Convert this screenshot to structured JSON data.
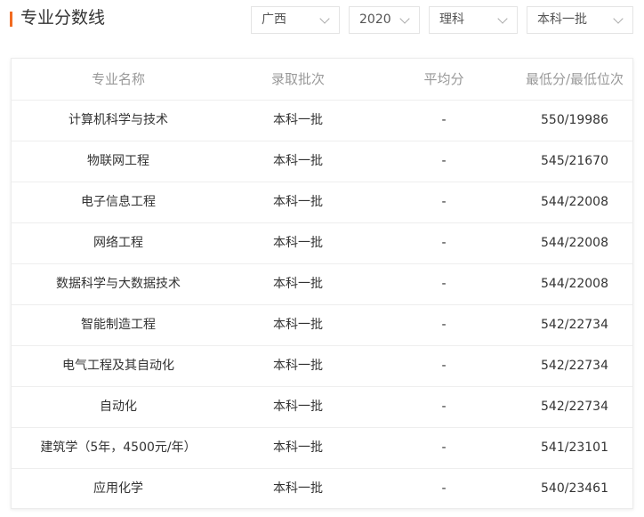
{
  "header": {
    "title": "专业分数线"
  },
  "filters": {
    "province": "广西",
    "year": "2020",
    "subject": "理科",
    "batch": "本科一批"
  },
  "table": {
    "columns": [
      "专业名称",
      "录取批次",
      "平均分",
      "最低分/最低位次"
    ],
    "rows": [
      {
        "major": "计算机科学与技术",
        "batch": "本科一批",
        "avg": "-",
        "min": "550/19986"
      },
      {
        "major": "物联网工程",
        "batch": "本科一批",
        "avg": "-",
        "min": "545/21670"
      },
      {
        "major": "电子信息工程",
        "batch": "本科一批",
        "avg": "-",
        "min": "544/22008"
      },
      {
        "major": "网络工程",
        "batch": "本科一批",
        "avg": "-",
        "min": "544/22008"
      },
      {
        "major": "数据科学与大数据技术",
        "batch": "本科一批",
        "avg": "-",
        "min": "544/22008"
      },
      {
        "major": "智能制造工程",
        "batch": "本科一批",
        "avg": "-",
        "min": "542/22734"
      },
      {
        "major": "电气工程及其自动化",
        "batch": "本科一批",
        "avg": "-",
        "min": "542/22734"
      },
      {
        "major": "自动化",
        "batch": "本科一批",
        "avg": "-",
        "min": "542/22734"
      },
      {
        "major": "建筑学（5年，4500元/年）",
        "batch": "本科一批",
        "avg": "-",
        "min": "541/23101"
      },
      {
        "major": "应用化学",
        "batch": "本科一批",
        "avg": "-",
        "min": "540/23461"
      }
    ]
  },
  "colors": {
    "accent": "#f26b21",
    "header_text": "#999999",
    "body_text": "#333333",
    "border": "#eeeeee"
  }
}
